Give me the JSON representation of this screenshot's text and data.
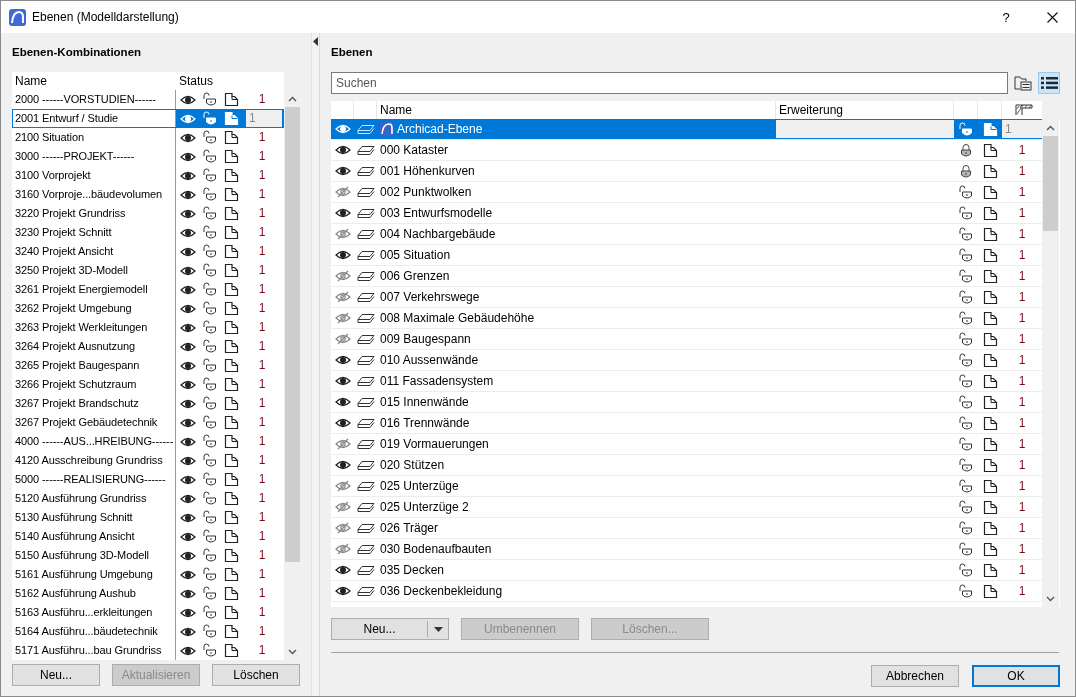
{
  "window": {
    "title": "Ebenen (Modelldarstellung)",
    "help": "?"
  },
  "combinations": {
    "title": "Ebenen-Kombinationen",
    "columns": [
      "Name",
      "Status"
    ],
    "rows": [
      {
        "name": "2000 ------VORSTUDIEN------",
        "number": "1",
        "selected": false
      },
      {
        "name": "2001 Entwurf / Studie",
        "number": "1",
        "selected": true
      },
      {
        "name": "2100 Situation",
        "number": "1",
        "selected": false
      },
      {
        "name": "3000 ------PROJEKT------",
        "number": "1",
        "selected": false
      },
      {
        "name": "3100 Vorprojekt",
        "number": "1",
        "selected": false
      },
      {
        "name": "3160 Vorproje...bäudevolumen",
        "number": "1",
        "selected": false
      },
      {
        "name": "3220 Projekt Grundriss",
        "number": "1",
        "selected": false
      },
      {
        "name": "3230 Projekt Schnitt",
        "number": "1",
        "selected": false
      },
      {
        "name": "3240 Projekt Ansicht",
        "number": "1",
        "selected": false
      },
      {
        "name": "3250 Projekt 3D-Modell",
        "number": "1",
        "selected": false
      },
      {
        "name": "3261 Projekt Energiemodell",
        "number": "1",
        "selected": false
      },
      {
        "name": "3262 Projekt Umgebung",
        "number": "1",
        "selected": false
      },
      {
        "name": "3263 Projekt Werkleitungen",
        "number": "1",
        "selected": false
      },
      {
        "name": "3264 Projekt Ausnutzung",
        "number": "1",
        "selected": false
      },
      {
        "name": "3265 Projekt Baugespann",
        "number": "1",
        "selected": false
      },
      {
        "name": "3266 Projekt Schutzraum",
        "number": "1",
        "selected": false
      },
      {
        "name": "3267 Projekt Brandschutz",
        "number": "1",
        "selected": false
      },
      {
        "name": "3267 Projekt Gebäudetechnik",
        "number": "1",
        "selected": false
      },
      {
        "name": "4000 ------AUS...HREIBUNG------",
        "number": "1",
        "selected": false
      },
      {
        "name": "4120 Ausschreibung Grundriss",
        "number": "1",
        "selected": false
      },
      {
        "name": "5000 ------REALISIERUNG------",
        "number": "1",
        "selected": false
      },
      {
        "name": "5120 Ausführung Grundriss",
        "number": "1",
        "selected": false
      },
      {
        "name": "5130 Ausführung Schnitt",
        "number": "1",
        "selected": false
      },
      {
        "name": "5140 Ausführung Ansicht",
        "number": "1",
        "selected": false
      },
      {
        "name": "5150 Ausführung 3D-Modell",
        "number": "1",
        "selected": false
      },
      {
        "name": "5161 Ausführung Umgebung",
        "number": "1",
        "selected": false
      },
      {
        "name": "5162 Ausführung Aushub",
        "number": "1",
        "selected": false
      },
      {
        "name": "5163 Ausführu...erkleitungen",
        "number": "1",
        "selected": false
      },
      {
        "name": "5164 Ausführu...bäudetechnik",
        "number": "1",
        "selected": false
      },
      {
        "name": "5171 Ausführu...bau Grundriss",
        "number": "1",
        "selected": false
      }
    ],
    "buttons": [
      {
        "label": "Neu...",
        "disabled": false
      },
      {
        "label": "Aktualisieren",
        "disabled": true
      },
      {
        "label": "Löschen",
        "disabled": false
      }
    ]
  },
  "layers": {
    "title": "Ebenen",
    "search": {
      "placeholder": "Suchen"
    },
    "columns": [
      "Name",
      "Erweiterung"
    ],
    "rows": [
      {
        "name": "Archicad-Ebene",
        "kind": "archicad",
        "visible": true,
        "locked": false,
        "number": "1",
        "selected": true
      },
      {
        "name": "000 Kataster",
        "kind": "layer",
        "visible": true,
        "locked": true,
        "number": "1",
        "selected": false
      },
      {
        "name": "001 Höhenkurven",
        "kind": "layer",
        "visible": true,
        "locked": true,
        "number": "1",
        "selected": false
      },
      {
        "name": "002 Punktwolken",
        "kind": "layer",
        "visible": false,
        "locked": false,
        "number": "1",
        "selected": false
      },
      {
        "name": "003 Entwurfsmodelle",
        "kind": "layer",
        "visible": true,
        "locked": false,
        "number": "1",
        "selected": false
      },
      {
        "name": "004 Nachbargebäude",
        "kind": "layer",
        "visible": false,
        "locked": false,
        "number": "1",
        "selected": false
      },
      {
        "name": "005 Situation",
        "kind": "layer",
        "visible": true,
        "locked": false,
        "number": "1",
        "selected": false
      },
      {
        "name": "006 Grenzen",
        "kind": "layer",
        "visible": false,
        "locked": false,
        "number": "1",
        "selected": false
      },
      {
        "name": "007 Verkehrswege",
        "kind": "layer",
        "visible": false,
        "locked": false,
        "number": "1",
        "selected": false
      },
      {
        "name": "008 Maximale Gebäudehöhe",
        "kind": "layer",
        "visible": false,
        "locked": false,
        "number": "1",
        "selected": false
      },
      {
        "name": "009 Baugespann",
        "kind": "layer",
        "visible": false,
        "locked": false,
        "number": "1",
        "selected": false
      },
      {
        "name": "010 Aussenwände",
        "kind": "layer",
        "visible": true,
        "locked": false,
        "number": "1",
        "selected": false
      },
      {
        "name": "011 Fassadensystem",
        "kind": "layer",
        "visible": true,
        "locked": false,
        "number": "1",
        "selected": false
      },
      {
        "name": "015 Innenwände",
        "kind": "layer",
        "visible": true,
        "locked": false,
        "number": "1",
        "selected": false
      },
      {
        "name": "016 Trennwände",
        "kind": "layer",
        "visible": true,
        "locked": false,
        "number": "1",
        "selected": false
      },
      {
        "name": "019 Vormauerungen",
        "kind": "layer",
        "visible": false,
        "locked": false,
        "number": "1",
        "selected": false
      },
      {
        "name": "020 Stützen",
        "kind": "layer",
        "visible": true,
        "locked": false,
        "number": "1",
        "selected": false
      },
      {
        "name": "025 Unterzüge",
        "kind": "layer",
        "visible": false,
        "locked": false,
        "number": "1",
        "selected": false
      },
      {
        "name": "025 Unterzüge 2",
        "kind": "layer",
        "visible": false,
        "locked": false,
        "number": "1",
        "selected": false
      },
      {
        "name": "026 Träger",
        "kind": "layer",
        "visible": false,
        "locked": false,
        "number": "1",
        "selected": false
      },
      {
        "name": "030 Bodenaufbauten",
        "kind": "layer",
        "visible": false,
        "locked": false,
        "number": "1",
        "selected": false
      },
      {
        "name": "035 Decken",
        "kind": "layer",
        "visible": true,
        "locked": false,
        "number": "1",
        "selected": false
      },
      {
        "name": "036 Deckenbekleidung",
        "kind": "layer",
        "visible": true,
        "locked": false,
        "number": "1",
        "selected": false
      }
    ],
    "buttons": [
      {
        "label": "Neu...",
        "disabled": false
      },
      {
        "label": "Umbenennen",
        "disabled": true
      },
      {
        "label": "Löschen...",
        "disabled": true
      }
    ]
  },
  "footer": {
    "buttons": [
      {
        "label": "Abbrechen",
        "default": false
      },
      {
        "label": "OK",
        "default": true
      }
    ]
  }
}
